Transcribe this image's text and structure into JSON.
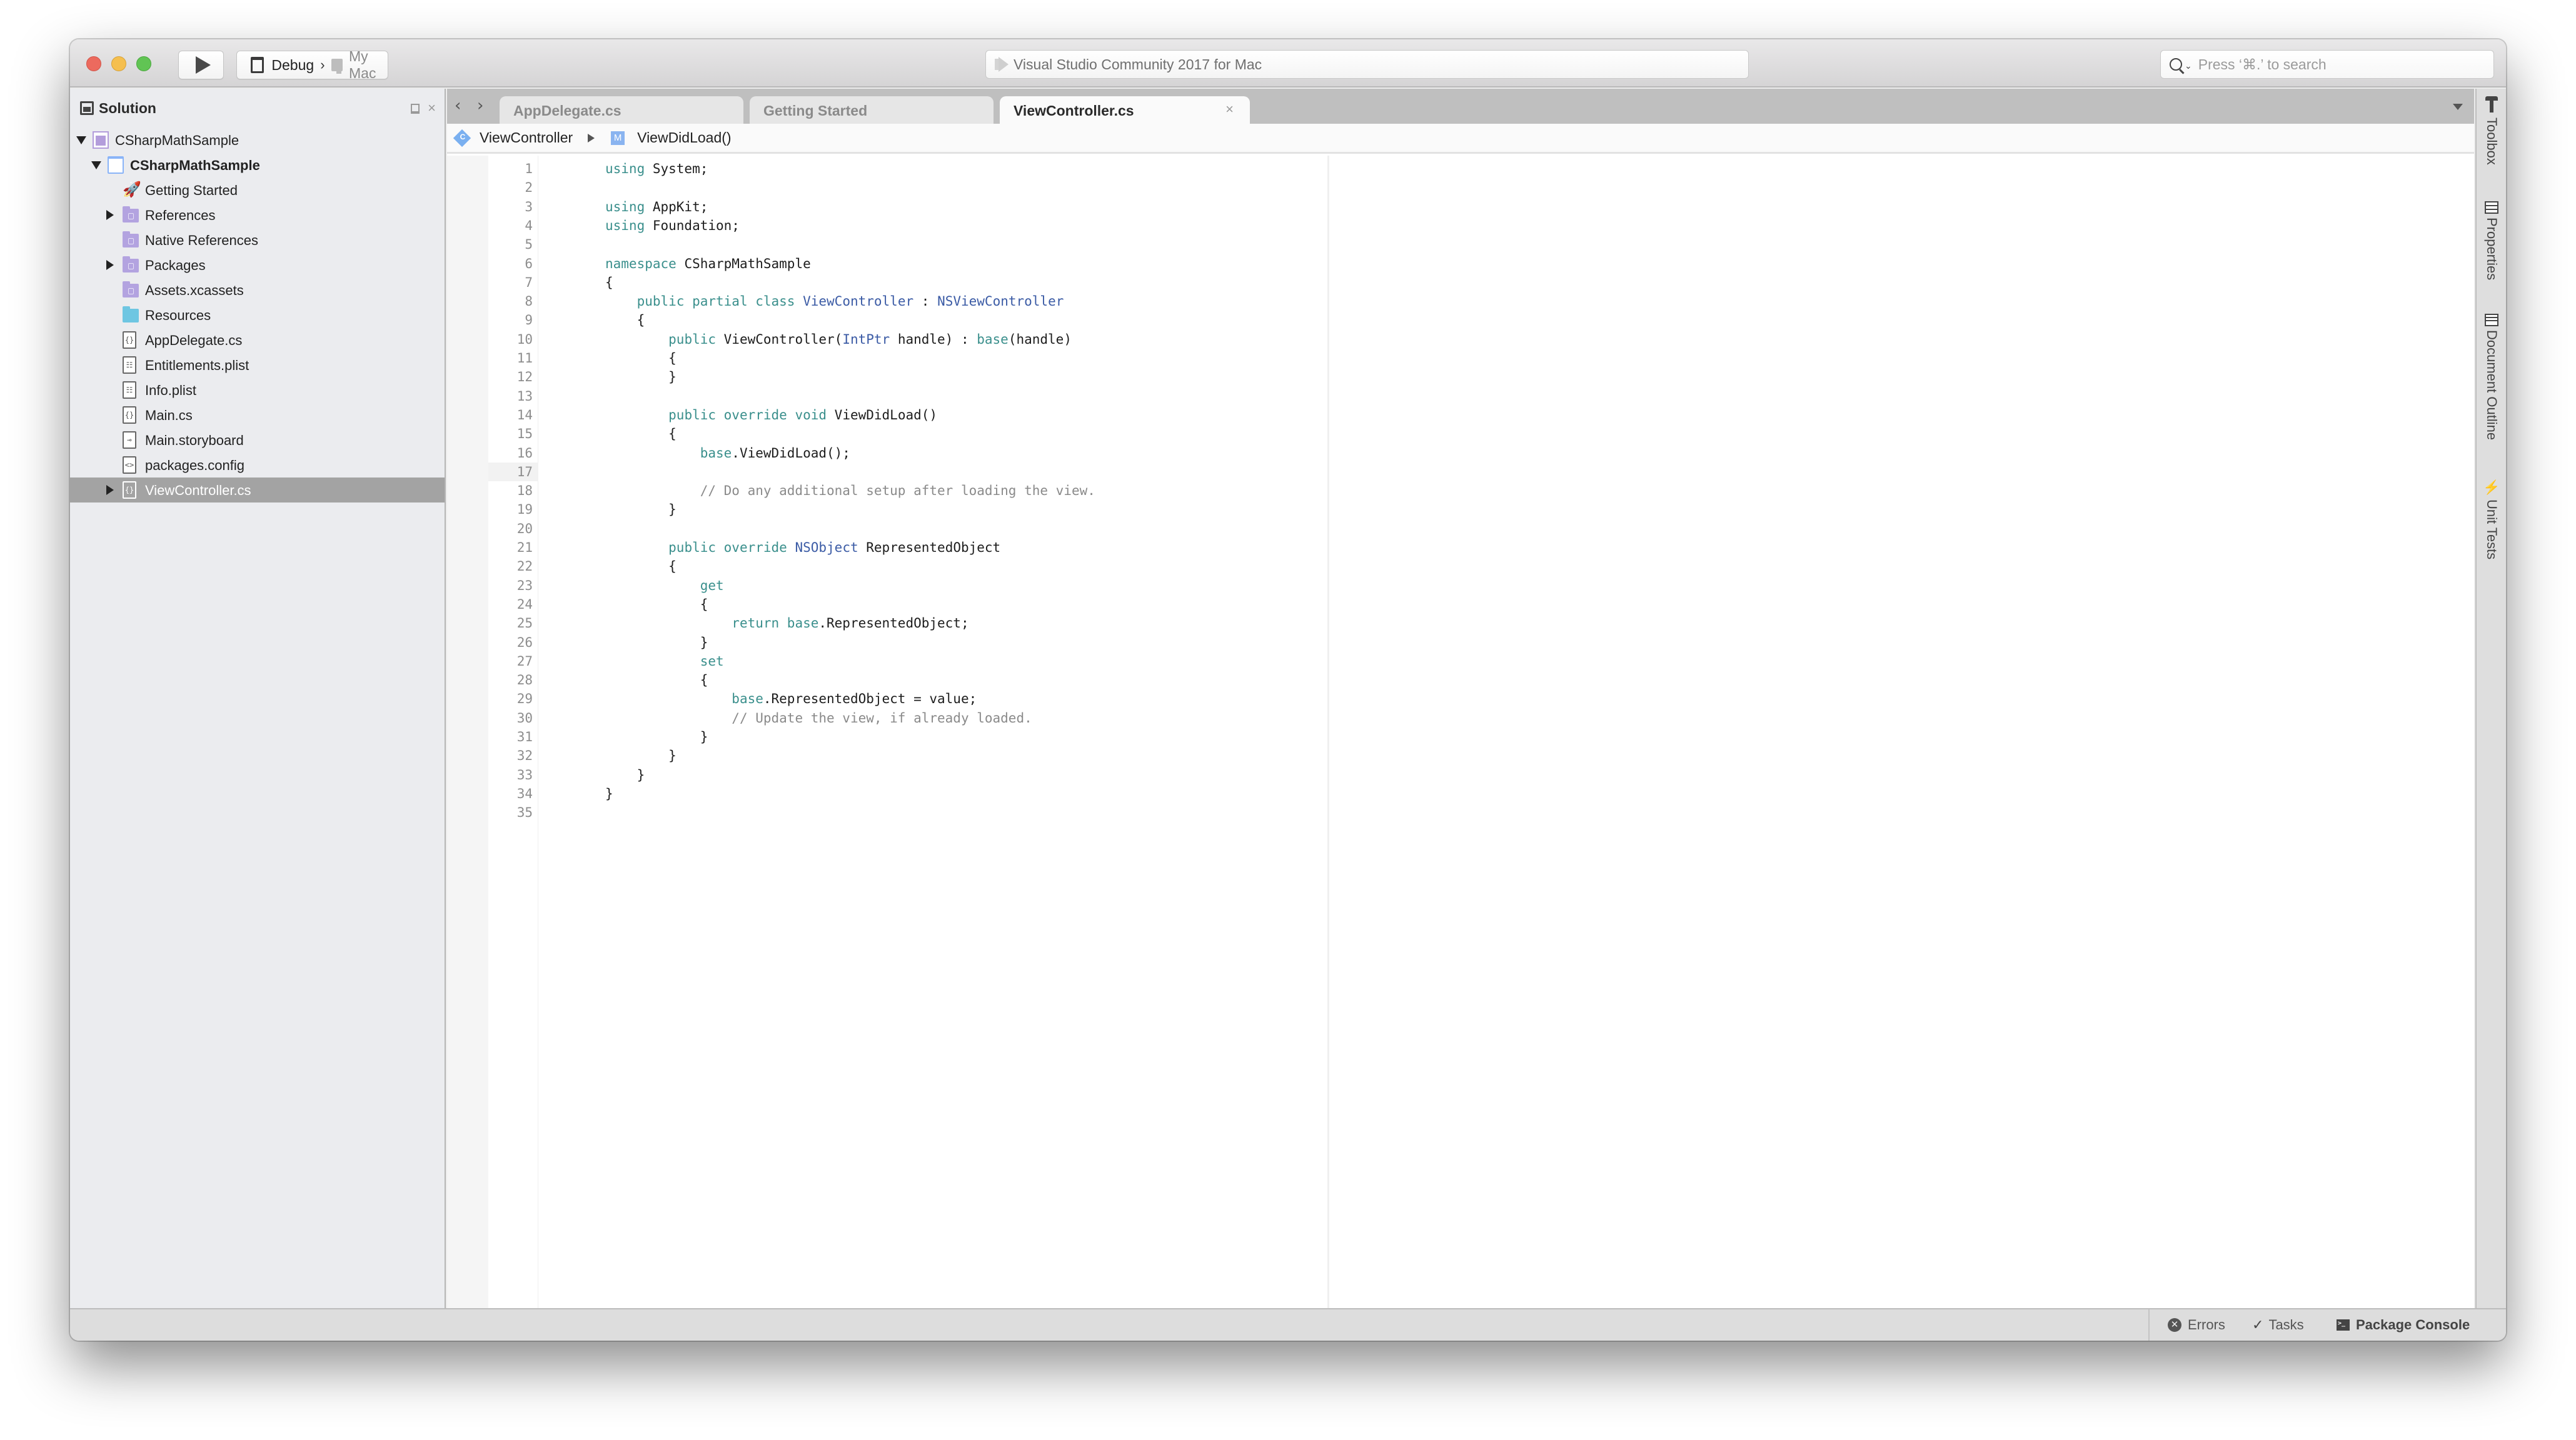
{
  "window": {
    "title": "Visual Studio Community 2017 for Mac",
    "traffic_lights": {
      "close": "#ec6a5e",
      "minimize": "#f5bf4f",
      "zoom": "#61c454"
    }
  },
  "toolbar": {
    "run_icon": "play-icon",
    "configuration": "Debug",
    "config_separator": "›",
    "target": "My Mac",
    "status_text": "Visual Studio Community 2017 for Mac",
    "search_placeholder": "Press ‘⌘.’ to search",
    "search_value": ""
  },
  "sidebar": {
    "title": "Solution",
    "close_label": "×",
    "tree": [
      {
        "label": "CSharpMathSample",
        "icon": "solution-icon",
        "level": 0,
        "expander": "open",
        "bold": false
      },
      {
        "label": "CSharpMathSample",
        "icon": "project-icon",
        "level": 1,
        "expander": "open",
        "bold": true
      },
      {
        "label": "Getting Started",
        "icon": "rocket-icon",
        "level": 2,
        "expander": "none"
      },
      {
        "label": "References",
        "icon": "folder-references-icon",
        "level": 2,
        "expander": "closed"
      },
      {
        "label": "Native References",
        "icon": "folder-references-icon",
        "level": 2,
        "expander": "none"
      },
      {
        "label": "Packages",
        "icon": "folder-packages-icon",
        "level": 2,
        "expander": "closed"
      },
      {
        "label": "Assets.xcassets",
        "icon": "folder-assets-icon",
        "level": 2,
        "expander": "none"
      },
      {
        "label": "Resources",
        "icon": "folder-icon",
        "level": 2,
        "expander": "none"
      },
      {
        "label": "AppDelegate.cs",
        "icon": "csharp-file-icon",
        "glyph": "{}",
        "level": 2,
        "expander": "none"
      },
      {
        "label": "Entitlements.plist",
        "icon": "plist-file-icon",
        "glyph": "☷",
        "level": 2,
        "expander": "none"
      },
      {
        "label": "Info.plist",
        "icon": "plist-file-icon",
        "glyph": "☷",
        "level": 2,
        "expander": "none"
      },
      {
        "label": "Main.cs",
        "icon": "csharp-file-icon",
        "glyph": "{}",
        "level": 2,
        "expander": "none"
      },
      {
        "label": "Main.storyboard",
        "icon": "storyboard-file-icon",
        "glyph": "⊸",
        "level": 2,
        "expander": "none"
      },
      {
        "label": "packages.config",
        "icon": "config-file-icon",
        "glyph": "<>",
        "level": 2,
        "expander": "none"
      },
      {
        "label": "ViewController.cs",
        "icon": "csharp-file-icon",
        "glyph": "{}",
        "level": 2,
        "expander": "closed",
        "selected": true
      }
    ]
  },
  "tabs": [
    {
      "label": "AppDelegate.cs",
      "active": false
    },
    {
      "label": "Getting Started",
      "active": false
    },
    {
      "label": "ViewController.cs",
      "active": true,
      "close_label": "×"
    }
  ],
  "nav": {
    "back": "‹",
    "forward": "›"
  },
  "breadcrumb": {
    "class_icon_letter": "C",
    "class_name": "ViewController",
    "method_icon_letter": "M",
    "method_name": "ViewDidLoad()"
  },
  "editor": {
    "highlighted_line": 17,
    "syntax_colors": {
      "keyword": "#3a8f8c",
      "type": "#3b5ba5",
      "comment": "#8a8a8a",
      "text": "#1d1d1d"
    },
    "lines": [
      [
        [
          "kw",
          "using"
        ],
        [
          "id",
          " System;"
        ]
      ],
      [],
      [
        [
          "kw",
          "using"
        ],
        [
          "id",
          " AppKit;"
        ]
      ],
      [
        [
          "kw",
          "using"
        ],
        [
          "id",
          " Foundation;"
        ]
      ],
      [],
      [
        [
          "kw",
          "namespace"
        ],
        [
          "id",
          " CSharpMathSample"
        ]
      ],
      [
        [
          "id",
          "{"
        ]
      ],
      [
        [
          "id",
          "    "
        ],
        [
          "kw",
          "public partial class"
        ],
        [
          "id",
          " "
        ],
        [
          "type",
          "ViewController"
        ],
        [
          "id",
          " : "
        ],
        [
          "type",
          "NSViewController"
        ]
      ],
      [
        [
          "id",
          "    {"
        ]
      ],
      [
        [
          "id",
          "        "
        ],
        [
          "kw",
          "public"
        ],
        [
          "id",
          " ViewController("
        ],
        [
          "type",
          "IntPtr"
        ],
        [
          "id",
          " handle) : "
        ],
        [
          "kw",
          "base"
        ],
        [
          "id",
          "(handle)"
        ]
      ],
      [
        [
          "id",
          "        {"
        ]
      ],
      [
        [
          "id",
          "        }"
        ]
      ],
      [],
      [
        [
          "id",
          "        "
        ],
        [
          "kw",
          "public override void"
        ],
        [
          "id",
          " ViewDidLoad()"
        ]
      ],
      [
        [
          "id",
          "        {"
        ]
      ],
      [
        [
          "id",
          "            "
        ],
        [
          "kw",
          "base"
        ],
        [
          "id",
          ".ViewDidLoad();"
        ]
      ],
      [],
      [
        [
          "id",
          "            "
        ],
        [
          "cm",
          "// Do any additional setup after loading the view."
        ]
      ],
      [
        [
          "id",
          "        }"
        ]
      ],
      [],
      [
        [
          "id",
          "        "
        ],
        [
          "kw",
          "public override"
        ],
        [
          "id",
          " "
        ],
        [
          "type",
          "NSObject"
        ],
        [
          "id",
          " RepresentedObject"
        ]
      ],
      [
        [
          "id",
          "        {"
        ]
      ],
      [
        [
          "id",
          "            "
        ],
        [
          "kw",
          "get"
        ]
      ],
      [
        [
          "id",
          "            {"
        ]
      ],
      [
        [
          "id",
          "                "
        ],
        [
          "kw",
          "return base"
        ],
        [
          "id",
          ".RepresentedObject;"
        ]
      ],
      [
        [
          "id",
          "            }"
        ]
      ],
      [
        [
          "id",
          "            "
        ],
        [
          "kw",
          "set"
        ]
      ],
      [
        [
          "id",
          "            {"
        ]
      ],
      [
        [
          "id",
          "                "
        ],
        [
          "kw",
          "base"
        ],
        [
          "id",
          ".RepresentedObject = value;"
        ]
      ],
      [
        [
          "id",
          "                "
        ],
        [
          "cm",
          "// Update the view, if already loaded."
        ]
      ],
      [
        [
          "id",
          "            }"
        ]
      ],
      [
        [
          "id",
          "        }"
        ]
      ],
      [
        [
          "id",
          "    }"
        ]
      ],
      [
        [
          "id",
          "}"
        ]
      ],
      []
    ],
    "status_icon": "check-icon"
  },
  "pads": [
    {
      "label": "Toolbox",
      "icon": "hammer-icon"
    },
    {
      "label": "Properties",
      "icon": "properties-icon"
    },
    {
      "label": "Document Outline",
      "icon": "outline-icon"
    },
    {
      "label": "Unit Tests",
      "icon": "bolt-icon"
    }
  ],
  "statusbar": {
    "errors_label": "Errors",
    "tasks_label": "Tasks",
    "console_label": "Package Console"
  }
}
